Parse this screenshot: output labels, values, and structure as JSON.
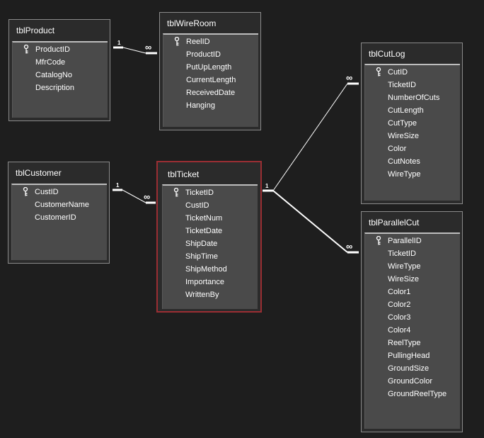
{
  "tables": {
    "product": {
      "title": "tblProduct",
      "fields": [
        "ProductID",
        "MfrCode",
        "CatalogNo",
        "Description"
      ]
    },
    "wireroom": {
      "title": "tblWireRoom",
      "fields": [
        "ReelID",
        "ProductID",
        "PutUpLength",
        "CurrentLength",
        "ReceivedDate",
        "Hanging"
      ]
    },
    "cutlog": {
      "title": "tblCutLog",
      "fields": [
        "CutID",
        "TicketID",
        "NumberOfCuts",
        "CutLength",
        "CutType",
        "WireSize",
        "Color",
        "CutNotes",
        "WireType"
      ]
    },
    "customer": {
      "title": "tblCustomer",
      "fields": [
        "CustID",
        "CustomerName",
        "CustomerID"
      ]
    },
    "ticket": {
      "title": "tblTicket",
      "fields": [
        "TicketID",
        "CustID",
        "TicketNum",
        "TicketDate",
        "ShipDate",
        "ShipTime",
        "ShipMethod",
        "Importance",
        "WrittenBy"
      ]
    },
    "parallelcut": {
      "title": "tblParallelCut",
      "fields": [
        "ParallelID",
        "TicketID",
        "WireType",
        "WireSize",
        "Color1",
        "Color2",
        "Color3",
        "Color4",
        "ReelType",
        "PullingHead",
        "GroundSize",
        "GroundColor",
        "GroundReelType"
      ]
    }
  },
  "relationships": {
    "one_label": "1",
    "many_label": "∞"
  },
  "colors": {
    "background": "#1e1e1e",
    "table_bg": "#2b2b2b",
    "field_bg": "#4a4a4a",
    "selected_border": "#9b2e33",
    "line": "#ffffff"
  }
}
